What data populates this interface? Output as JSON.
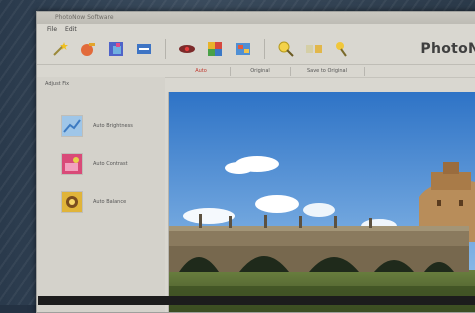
{
  "window": {
    "title": "PhotoNow Software"
  },
  "menu": {
    "items": [
      "File",
      "Edit"
    ]
  },
  "toolbar": {
    "brand": "PhotoNo"
  },
  "tabs": [
    {
      "label": "Auto",
      "active": true
    },
    {
      "label": "Original",
      "active": false
    },
    {
      "label": "Save to Original",
      "active": false
    }
  ],
  "sidebar": {
    "heading": "Adjust Fix",
    "items": [
      {
        "label": "Auto Brightness",
        "icon": "brightness-icon"
      },
      {
        "label": "Auto Contrast",
        "icon": "contrast-icon"
      },
      {
        "label": "Auto Balance",
        "icon": "balance-icon"
      }
    ]
  },
  "photo": {
    "subject": "bridge-and-castle-photo"
  },
  "colors": {
    "accent_tab": "#c0362c",
    "sky": "#3f7fc8",
    "window_bg": "#d9d7d0"
  }
}
